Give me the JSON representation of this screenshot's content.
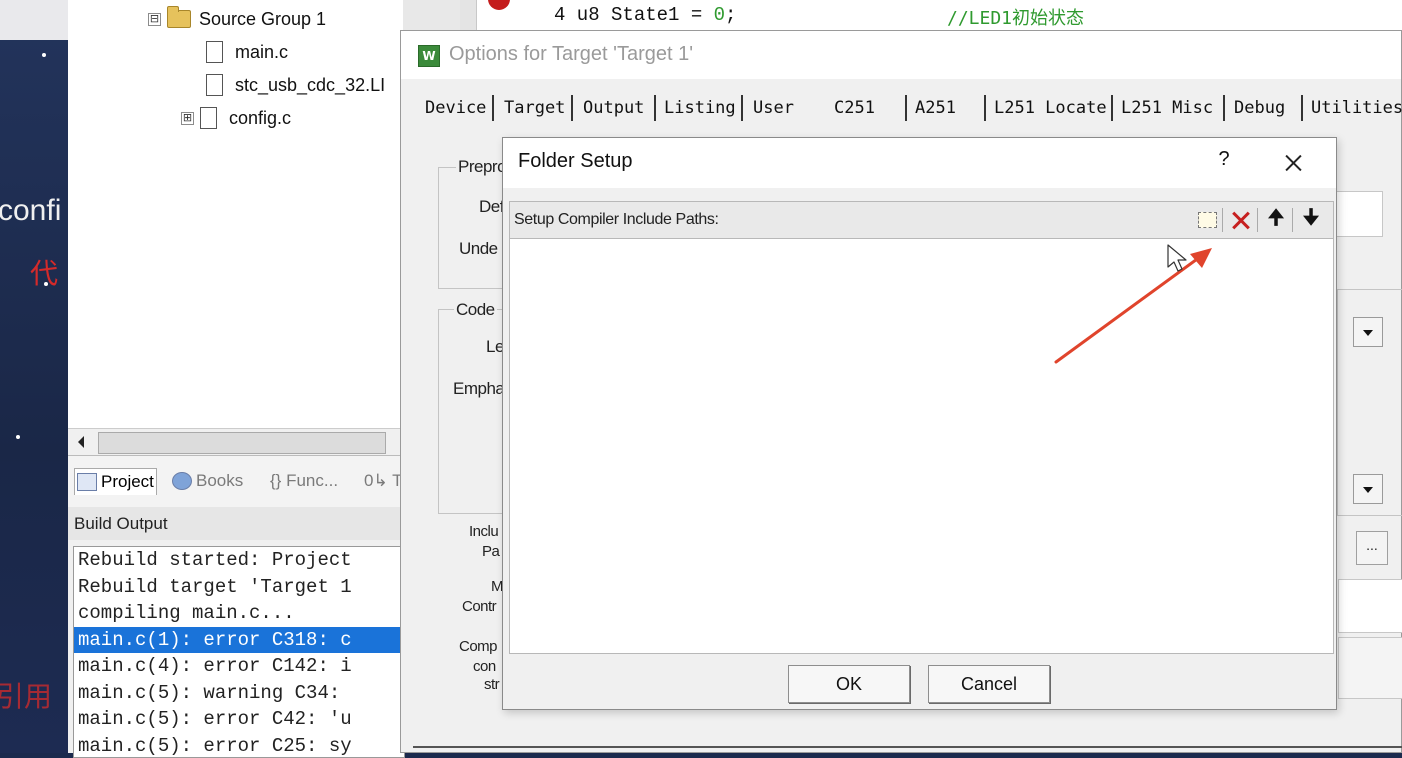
{
  "background": {
    "fragment_conf": "confi",
    "fragment_red_top": "代",
    "fragment_red_bottom": "引用",
    "colors": {
      "bg": "#1b2a4d",
      "red": "#d52a2a"
    }
  },
  "editor": {
    "code_line_prefix": "4 u8 State1 = ",
    "code_line_number": "0",
    "code_line_suffix": ";",
    "comment": "//LED1初始状态"
  },
  "project_tree": {
    "group": {
      "label": "Source Group 1",
      "expander": "⊟"
    },
    "files": [
      {
        "label": "main.c"
      },
      {
        "label": "stc_usb_cdc_32.LI"
      },
      {
        "label": "config.c",
        "expander": "⊞"
      }
    ]
  },
  "panel_tabs": [
    {
      "label": "Project"
    },
    {
      "label": "Books"
    },
    {
      "label": "{} Func..."
    },
    {
      "label": "0↳ T"
    }
  ],
  "build_output": {
    "title": "Build Output",
    "lines": [
      "Rebuild started: Project",
      "Rebuild target 'Target 1",
      "compiling main.c...",
      "main.c(1): error C318: c",
      "main.c(4): error C142: i",
      "main.c(5): warning C34:",
      "main.c(5): error C42: 'u",
      "main.c(5): error C25: sy"
    ],
    "selected_index": 3,
    "colors": {
      "selected": "#1a73d9"
    }
  },
  "options_dialog": {
    "icon_text": "W",
    "title": "Options for Target 'Target 1'",
    "tabs": [
      "Device",
      "Target",
      "Output",
      "Listing",
      "User",
      "C251",
      "A251",
      "L251 Locate",
      "L251 Misc",
      "Debug",
      "Utilities"
    ],
    "labels": {
      "preproc": "Prepro",
      "define": "Def",
      "undefine": "Unde",
      "code": "Code",
      "level": "Le",
      "emphasis": "Empha",
      "include_1": "Inclu",
      "include_2": "Pa",
      "misc_1": "M",
      "misc_2": "Contr",
      "compiler_1": "Comp",
      "compiler_2": "con",
      "compiler_3": "str"
    },
    "ellipsis_label": "..."
  },
  "folder_setup": {
    "title": "Folder Setup",
    "help_label": "?",
    "list_label": "Setup Compiler Include Paths:",
    "toolbar": {
      "new_icon": "new-folder-icon",
      "delete_icon": "delete-icon",
      "up_glyph": "🠉",
      "down_glyph": "🠋"
    },
    "ok_label": "OK",
    "cancel_label": "Cancel",
    "colors": {
      "delete": "#c62020",
      "annotation_arrow": "#e0442c"
    }
  }
}
